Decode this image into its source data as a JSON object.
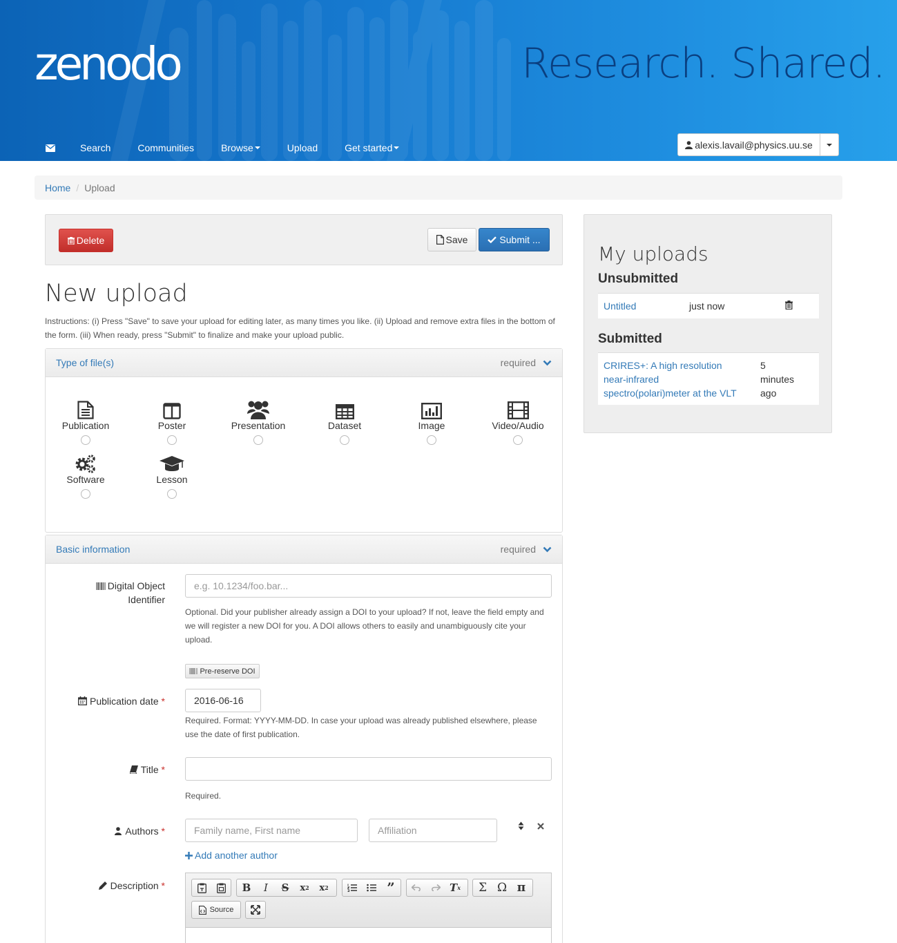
{
  "brand": {
    "logo": "zenodo",
    "tagline": "Research. Shared."
  },
  "nav": {
    "items": [
      {
        "label": "Search"
      },
      {
        "label": "Communities"
      },
      {
        "label": "Browse",
        "dropdown": true
      },
      {
        "label": "Upload"
      },
      {
        "label": "Get started",
        "dropdown": true
      }
    ],
    "user_email": "alexis.lavail@physics.uu.se"
  },
  "breadcrumb": {
    "home": "Home",
    "current": "Upload"
  },
  "actions": {
    "delete": "Delete",
    "save": "Save",
    "submit": "Submit ..."
  },
  "page": {
    "title": "New upload",
    "instructions": "Instructions: (i) Press \"Save\" to save your upload for editing later, as many times you like. (ii) Upload and remove extra files in the bottom of the form. (iii) When ready, press \"Submit\" to finalize and make your upload public."
  },
  "type_panel": {
    "title": "Type of file(s)",
    "required": "required",
    "types": [
      {
        "label": "Publication",
        "icon": "file-text-icon"
      },
      {
        "label": "Poster",
        "icon": "columns-icon"
      },
      {
        "label": "Presentation",
        "icon": "users-icon"
      },
      {
        "label": "Dataset",
        "icon": "table-icon"
      },
      {
        "label": "Image",
        "icon": "bar-chart-icon"
      },
      {
        "label": "Video/Audio",
        "icon": "film-icon"
      },
      {
        "label": "Software",
        "icon": "gears-icon"
      },
      {
        "label": "Lesson",
        "icon": "graduation-cap-icon"
      }
    ]
  },
  "basic_panel": {
    "title": "Basic information",
    "required": "required",
    "doi": {
      "label_line1": "Digital Object",
      "label_line2": "Identifier",
      "placeholder": "e.g. 10.1234/foo.bar...",
      "help": "Optional. Did your publisher already assign a DOI to your upload? If not, leave the field empty and we will register a new DOI for you. A DOI allows others to easily and unambiguously cite your upload.",
      "preserve_button": "Pre-reserve DOI"
    },
    "pubdate": {
      "label": "Publication date",
      "value": "2016-06-16",
      "help": "Required. Format: YYYY-MM-DD. In case your upload was already published elsewhere, please use the date of first publication."
    },
    "title_field": {
      "label": "Title",
      "value": "",
      "help": "Required."
    },
    "authors": {
      "label": "Authors",
      "name_placeholder": "Family name, First name",
      "affiliation_placeholder": "Affiliation",
      "add_link": "Add another author"
    },
    "description": {
      "label": "Description",
      "source_button": "Source"
    }
  },
  "sidebar": {
    "title": "My uploads",
    "unsubmitted_heading": "Unsubmitted",
    "unsubmitted": [
      {
        "title": "Untitled",
        "time": "just now"
      }
    ],
    "submitted_heading": "Submitted",
    "submitted": [
      {
        "title_line1": "CRIRES+: A high resolution",
        "title_line2": "near-infrared",
        "title_line3": "spectro(polari)meter at the VLT",
        "time_line1": "5",
        "time_line2": "minutes",
        "time_line3": "ago"
      }
    ]
  },
  "colors": {
    "header_start": "#0c63b6",
    "header_end": "#27a0ea",
    "link": "#337ab7",
    "danger": "#d9534f",
    "primary": "#2a6fb3",
    "required": "#c9302c"
  }
}
